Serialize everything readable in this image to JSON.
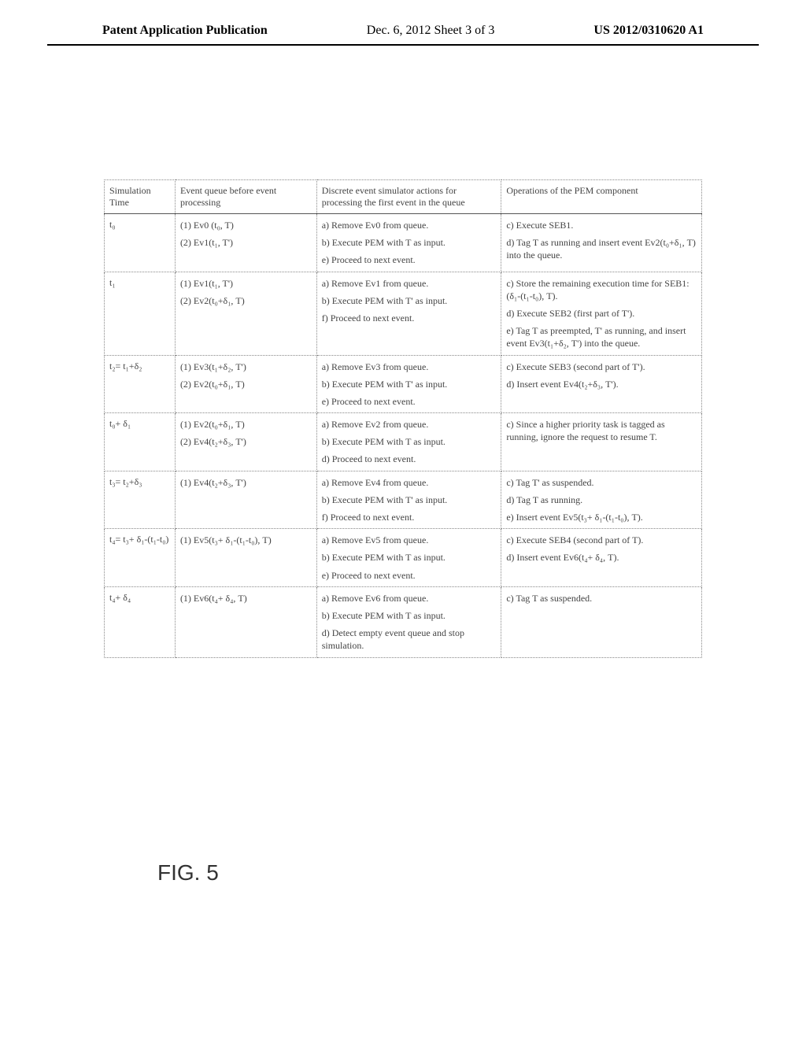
{
  "header": {
    "left": "Patent Application Publication",
    "center": "Dec. 6, 2012   Sheet 3 of 3",
    "right": "US 2012/0310620 A1"
  },
  "table": {
    "headers": {
      "time": "Simulation Time",
      "queue": "Event queue before event processing",
      "actions": "Discrete event simulator actions for processing the first event in the queue",
      "pem": "Operations of the PEM component"
    },
    "rows": [
      {
        "time": "t₀",
        "queue": [
          "(1)  Ev0 (t₀, T)",
          "(2)  Ev1(t₁, T')"
        ],
        "actions": [
          "a) Remove Ev0 from queue.",
          "b) Execute PEM with T as input.",
          "e) Proceed to next event."
        ],
        "pem": [
          "c) Execute SEB1.",
          "d) Tag T as running and insert event Ev2(t₀+δ₁, T) into the queue."
        ]
      },
      {
        "time": "t₁",
        "queue": [
          "(1)  Ev1(t₁, T')",
          "(2)  Ev2(t₀+δ₁, T)"
        ],
        "actions": [
          "a) Remove Ev1 from queue.",
          "b) Execute PEM with T' as input.",
          "f) Proceed to next event."
        ],
        "pem": [
          "c) Store the remaining execution time for SEB1: (δ₁-(t₁-t₀), T).",
          "d) Execute SEB2 (first part of T').",
          "e) Tag T as preempted, T' as running, and insert event Ev3(t₁+δ₂, T') into the queue."
        ]
      },
      {
        "time": "t₂= t₁+δ₂",
        "queue": [
          "(1)  Ev3(t₁+δ₂, T')",
          "(2)  Ev2(t₀+δ₁, T)"
        ],
        "actions": [
          "a) Remove Ev3 from queue.",
          "b) Execute PEM with T' as input.",
          "e) Proceed to next event."
        ],
        "pem": [
          "c) Execute SEB3 (second part of T').",
          "d) Insert event Ev4(t₂+δ₃, T')."
        ]
      },
      {
        "time": "t₀+ δ₁",
        "queue": [
          "(1)  Ev2(t₀+δ₁, T)",
          "(2)  Ev4(t₂+δ₃, T')"
        ],
        "actions": [
          "a) Remove Ev2 from queue.",
          "b) Execute PEM with T as input.",
          "d) Proceed to next event."
        ],
        "pem": [
          "c) Since a higher priority task is tagged as running, ignore the request to resume T."
        ]
      },
      {
        "time": "t₃= t₂+δ₃",
        "queue": [
          "(1)  Ev4(t₂+δ₃, T')"
        ],
        "actions": [
          "a) Remove Ev4 from queue.",
          "b) Execute PEM with T' as input.",
          "f) Proceed to next event."
        ],
        "pem": [
          "c) Tag T' as suspended.",
          "d) Tag T as running.",
          "e) Insert event Ev5(t₃+ δ₁-(t₁-t₀), T)."
        ]
      },
      {
        "time": "t₄= t₃+ δ₁-(t₁-t₀)",
        "queue": [
          "(1)  Ev5(t₃+ δ₁-(t₁-t₀), T)"
        ],
        "actions": [
          "a) Remove Ev5 from queue.",
          "b) Execute PEM with T as input.",
          "e) Proceed to next event."
        ],
        "pem": [
          "c) Execute SEB4 (second part of T).",
          "d) Insert event Ev6(t₄+ δ₄, T)."
        ]
      },
      {
        "time": "t₄+ δ₄",
        "queue": [
          "(1)  Ev6(t₄+ δ₄, T)"
        ],
        "actions": [
          "a) Remove Ev6 from queue.",
          "b) Execute PEM with T as input.",
          "d) Detect empty event queue and stop simulation."
        ],
        "pem": [
          "c) Tag T as suspended."
        ]
      }
    ]
  },
  "figure_label": "FIG. 5"
}
